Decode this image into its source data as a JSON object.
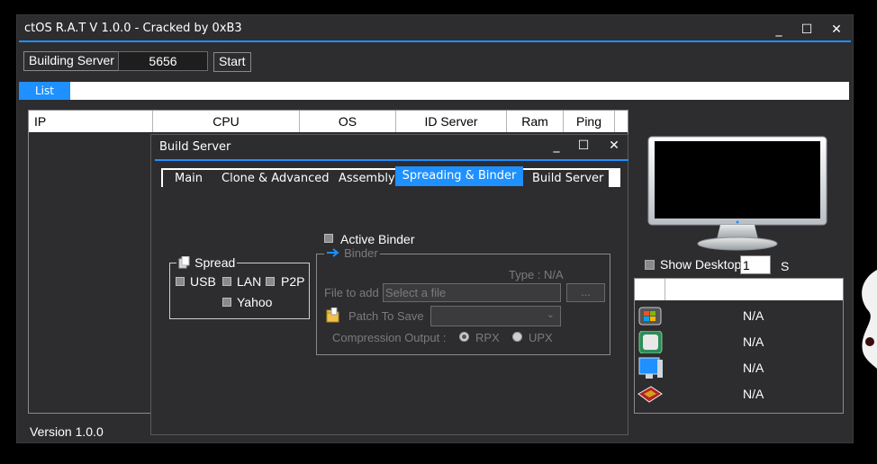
{
  "window": {
    "title": "ctOS R.A.T V 1.0.0 - Cracked by 0xB3",
    "minimize": "_",
    "maximize": "☐",
    "close": "✕"
  },
  "toolbar": {
    "build_label": "Building Server",
    "port_value": "5656",
    "start_label": "Start"
  },
  "tabs": {
    "list": "List"
  },
  "table": {
    "columns": [
      "IP",
      "CPU",
      "OS",
      "ID Server",
      "Ram",
      "Ping"
    ]
  },
  "status": {
    "version": "Version 1.0.0"
  },
  "desktop": {
    "show_label": "Show Desktop",
    "interval": "1",
    "unit": "S"
  },
  "info": {
    "values": [
      "N/A",
      "N/A",
      "N/A",
      "N/A"
    ],
    "icons": [
      "windows-icon",
      "green-square-icon",
      "monitor-icon",
      "ram-chip-icon"
    ]
  },
  "dialog": {
    "title": "Build Server",
    "minimize": "_",
    "maximize": "☐",
    "close": "✕",
    "tabs": [
      "Main",
      "Clone & Advanced",
      "Assembly",
      "Spreading & Binder",
      "Build Server"
    ],
    "active_tab": "Spreading & Binder",
    "spread": {
      "title": "Spread",
      "usb": "USB",
      "lan": "LAN",
      "p2p": "P2P",
      "yahoo": "Yahoo"
    },
    "binder": {
      "active_label": "Active Binder",
      "group_title": "Binder",
      "type_label": "Type : N/A",
      "file_label": "File to add",
      "file_placeholder": "Select a file",
      "browse": "...",
      "patch_label": "Patch To Save",
      "compression_label": "Compression Output :",
      "rpx": "RPX",
      "upx": "UPX"
    }
  },
  "colors": {
    "accent": "#1e90ff",
    "window_bg": "#2d2d30",
    "disabled": "#7b7b7b"
  }
}
